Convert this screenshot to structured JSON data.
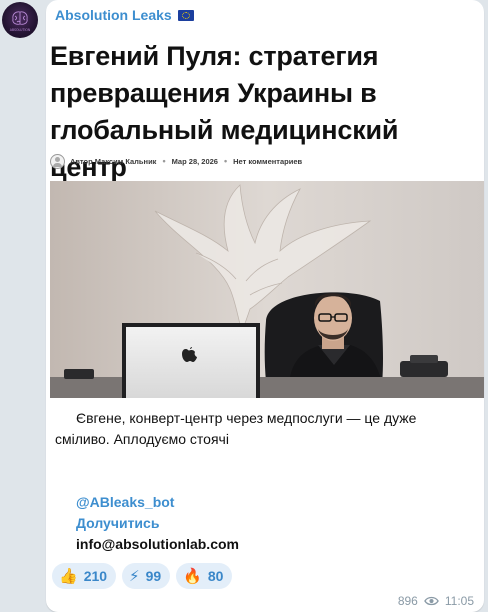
{
  "channel": {
    "name": "Absolution Leaks",
    "flag_icon": "eu-flag-icon",
    "avatar_icon": "brain-logo-icon",
    "avatar_text": "ABSOLUTION"
  },
  "article": {
    "title": "Евгений Пуля: стратегия превращения Украины в глобальный медицинский центр",
    "author": "Автор Максим Кальник",
    "date": "Мар 28, 2026",
    "comments": "Нет комментариев"
  },
  "message": {
    "text": "Євгене, конверт-центр через медпослуги — це дуже сміливо. Аплодуємо стоячі"
  },
  "links": {
    "bot": "@ABleaks_bot",
    "join": "Долучитись",
    "email": "info@absolutionlab.com"
  },
  "reactions": [
    {
      "emoji": "👍",
      "icon": "thumbs-up-icon",
      "count": "210"
    },
    {
      "emoji": "⚡",
      "icon": "lightning-icon",
      "count": "99"
    },
    {
      "emoji": "🔥",
      "icon": "fire-icon",
      "count": "80"
    }
  ],
  "footer": {
    "views": "896",
    "time": "11:05"
  },
  "colors": {
    "link": "#3d8ecf",
    "reaction_bg": "#e3eef9",
    "background": "#dfe5ea"
  }
}
